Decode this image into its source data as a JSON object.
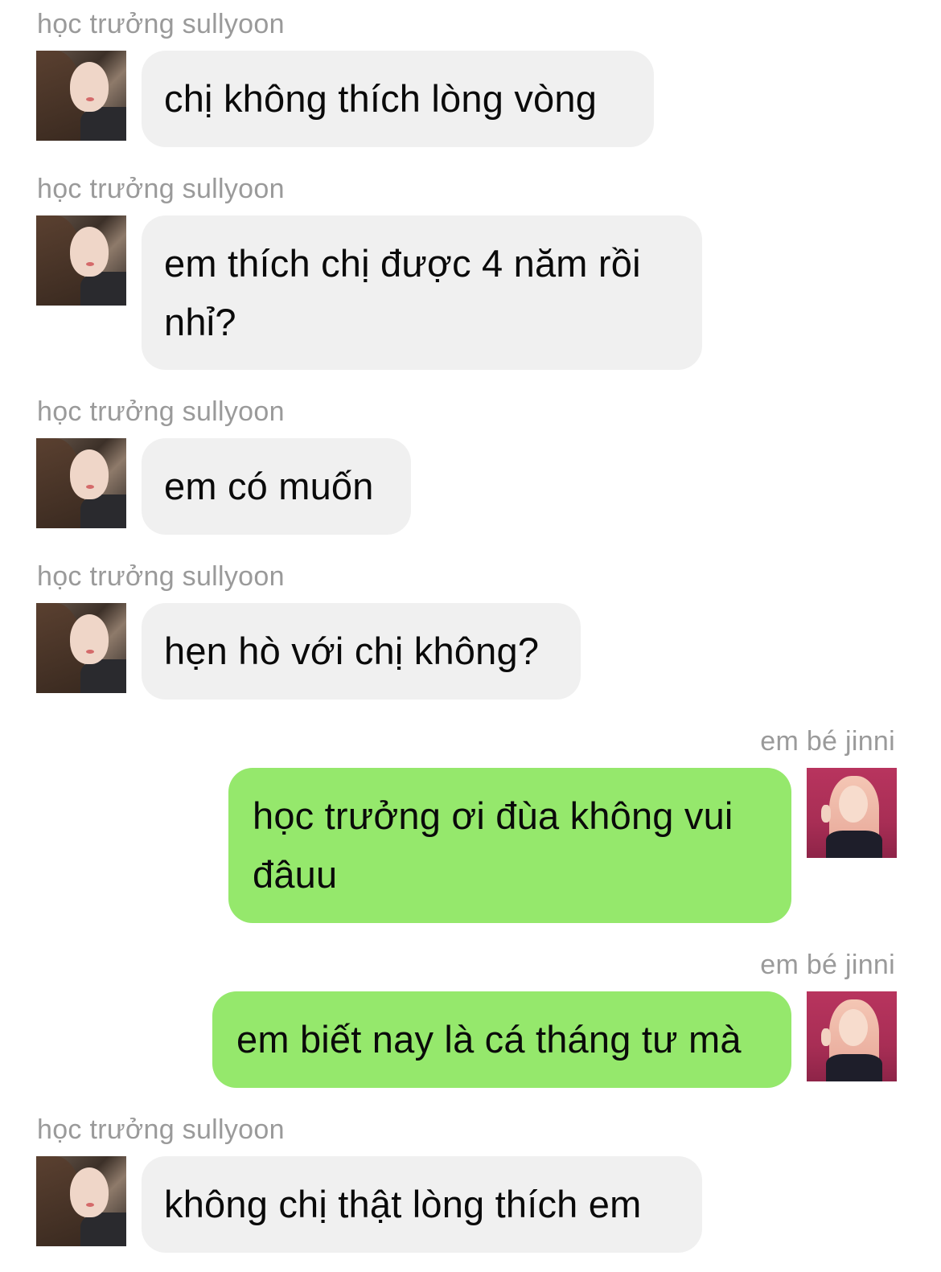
{
  "chat": {
    "messages": [
      {
        "side": "left",
        "sender": "học trưởng sullyoon",
        "avatar": "sullyoon-avatar",
        "text": "chị không thích lòng vòng"
      },
      {
        "side": "left",
        "sender": "học trưởng sullyoon",
        "avatar": "sullyoon-avatar",
        "text": "em thích chị được 4 năm rồi nhỉ?"
      },
      {
        "side": "left",
        "sender": "học trưởng sullyoon",
        "avatar": "sullyoon-avatar",
        "text": "em có muốn"
      },
      {
        "side": "left",
        "sender": "học trưởng sullyoon",
        "avatar": "sullyoon-avatar",
        "text": "hẹn hò với chị không?"
      },
      {
        "side": "right",
        "sender": "em bé jinni",
        "avatar": "jinni-avatar",
        "text": "học trưởng ơi đùa không vui đâuu"
      },
      {
        "side": "right",
        "sender": "em bé jinni",
        "avatar": "jinni-avatar",
        "text": "em biết nay là cá tháng tư mà"
      },
      {
        "side": "left",
        "sender": "học trưởng sullyoon",
        "avatar": "sullyoon-avatar",
        "text": "không chị thật lòng thích em"
      }
    ]
  },
  "colors": {
    "left_bubble": "#f0f0f0",
    "right_bubble": "#95e86c",
    "sender_name": "#9a9a9a",
    "text": "#0a0a0a"
  }
}
